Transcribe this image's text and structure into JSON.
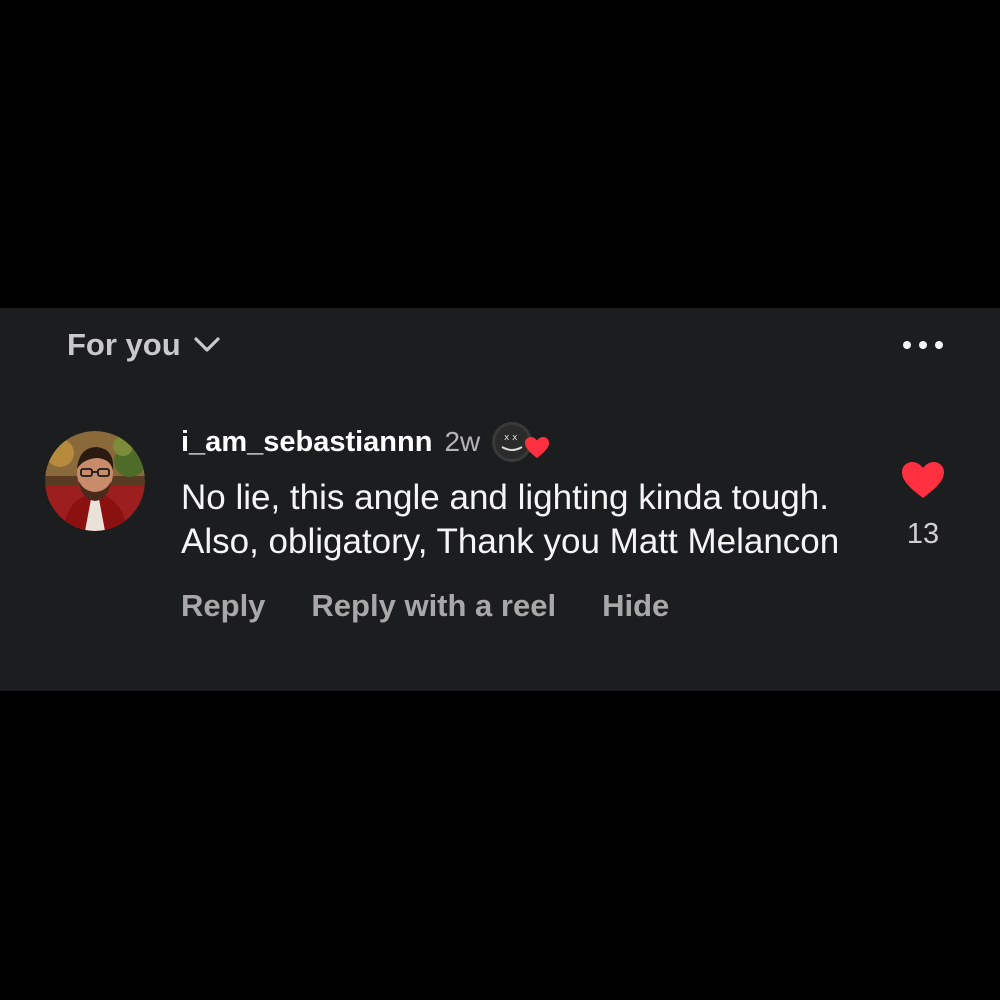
{
  "header": {
    "filter_label": "For you",
    "filter_icon": "chevron-down-icon",
    "more_icon": "more-options-icon"
  },
  "comment": {
    "username": "i_am_sebastiannn",
    "time": "2w",
    "text": "No lie, this angle and lighting kinda tough. Also, obligatory, Thank you Matt Melancon",
    "avatar_icon": "user-avatar",
    "liked_by_creator_icon": "creator-heart-icon",
    "actions": {
      "reply": "Reply",
      "reply_reel": "Reply with a reel",
      "hide": "Hide"
    },
    "like_count": "13",
    "like_icon": "heart-icon"
  },
  "colors": {
    "background": "#000000",
    "panel": "#1c1d1f",
    "heart": "#ff3040",
    "text_primary": "#f5f5f5",
    "text_secondary": "#a8a8a8"
  }
}
